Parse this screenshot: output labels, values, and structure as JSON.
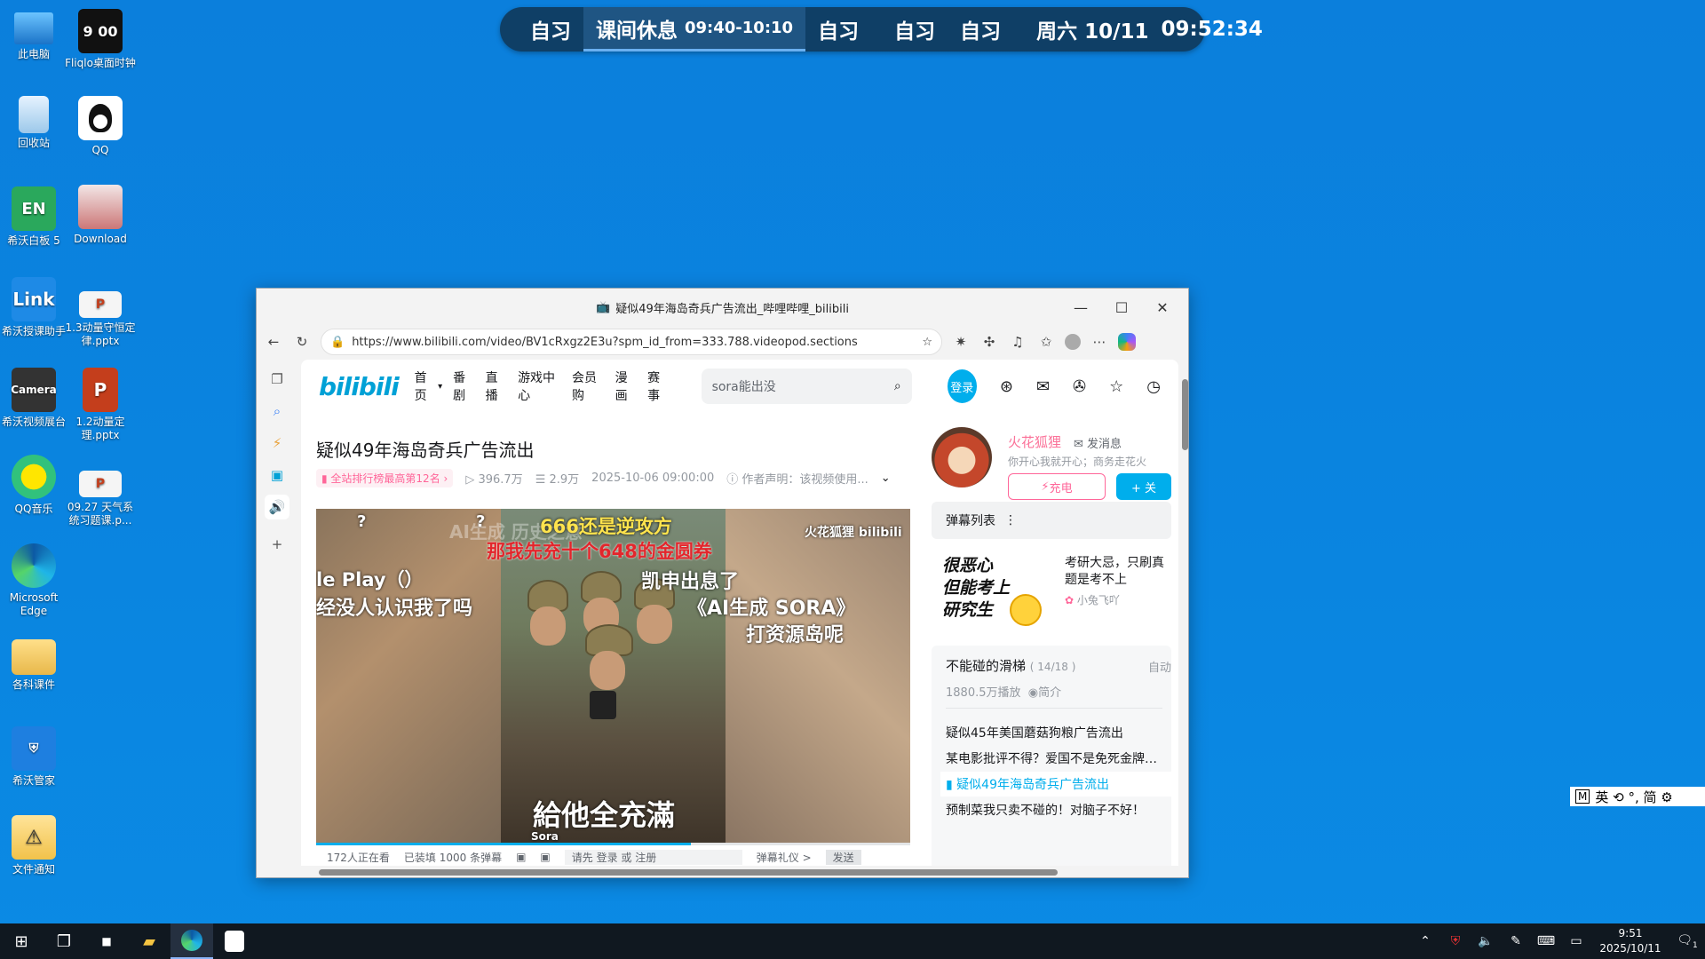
{
  "desktop": {
    "icons": [
      {
        "label": "此电脑",
        "icon": "computer-icon"
      },
      {
        "label": "Fliqlo桌面时钟",
        "icon": "clock-icon",
        "glyph": "9 00"
      },
      {
        "label": "回收站",
        "icon": "recycle-bin-icon"
      },
      {
        "label": "QQ",
        "icon": "qq-icon"
      },
      {
        "label": "希沃白板 5",
        "icon": "seewo-board-icon",
        "glyph": "EN"
      },
      {
        "label": "Download",
        "icon": "download-folder-icon"
      },
      {
        "label": "希沃授课助手",
        "icon": "seewo-link-icon",
        "glyph": "Link"
      },
      {
        "label": "1.3动量守恒定律.pptx",
        "icon": "pptx-file-icon",
        "glyph": "P"
      },
      {
        "label": "希沃视频展台",
        "icon": "camera-icon",
        "glyph": "Camera"
      },
      {
        "label": "1.2动量定理.pptx",
        "icon": "pptx-file-icon",
        "glyph": "P"
      },
      {
        "label": "QQ音乐",
        "icon": "qq-music-icon"
      },
      {
        "label": "09.27 天气系统习题课.p...",
        "icon": "pptx-file-icon",
        "glyph": "P"
      },
      {
        "label": "Microsoft Edge",
        "icon": "edge-icon"
      },
      {
        "label": "各科课件",
        "icon": "folder-icon"
      },
      {
        "label": "希沃管家",
        "icon": "seewo-guard-icon"
      },
      {
        "label": "文件通知",
        "icon": "file-warning-icon"
      }
    ]
  },
  "schedule": {
    "items": [
      "自习",
      "课间休息",
      "09:40-10:10",
      "自习",
      "自习",
      "自习"
    ],
    "date": "周六 10/11",
    "time": "09:52:34"
  },
  "browser": {
    "window_title": "疑似49年海岛奇兵广告流出_哔哩哔哩_bilibili",
    "url": "https://www.bilibili.com/video/BV1cRxgz2E3u?spm_id_from=333.788.videopod.sections",
    "controls": {
      "minimize": "—",
      "maximize": "☐",
      "close": "✕"
    }
  },
  "bili": {
    "logo": "bilibili",
    "nav": [
      "首页",
      "番剧",
      "直播",
      "游戏中心",
      "会员购",
      "漫画",
      "赛事"
    ],
    "search_placeholder": "sora能出没",
    "login": "登录",
    "video": {
      "title": "疑似49年海岛奇兵广告流出",
      "rank": "全站排行榜最高第12名",
      "views": "396.7万",
      "danmaku_count": "2.9万",
      "date": "2025-10-06 09:00:00",
      "statement": "作者声明：该视频使用..."
    },
    "player": {
      "dm_yellow": "666还是逆攻方",
      "dm_red": "那我先充十个648的金圆券",
      "dm_1": "凯申出息了",
      "dm_2": "《AI生成 SORA》",
      "dm_3": "打资源岛呢",
      "dm_left1": "le Play（）",
      "dm_left2": "经没人认识我了吗",
      "watermark": "火花狐狸 bilibili",
      "faded": "AI生成 历史之意",
      "subtitle": "給他全充滿",
      "sora": "Sora",
      "q1": "?",
      "q2": "?"
    },
    "controlbar": {
      "watching": "172人正在看",
      "loaded": "已装填 1000 条弹幕",
      "prompt": "请先 登录 或 注册",
      "etiquette": "弹幕礼仪 >",
      "send": "发送"
    },
    "uploader": {
      "name": "火花狐狸",
      "message": "发消息",
      "desc": "你开心我就开心；商务走花火",
      "charge": "充电",
      "follow": "+ 关"
    },
    "danmaku_list": "弹幕列表",
    "ad": {
      "big": [
        "很恶心",
        "但能考上",
        "研究生"
      ],
      "text": "考研大忌，只刷真题是考不上",
      "author": "小兔飞吖"
    },
    "collection": {
      "title": "不能碰的滑梯",
      "count": "( 14/18 )",
      "auto": "自动",
      "plays": "1880.5万播放",
      "intro": "简介",
      "episodes": [
        "疑似45年美国蘑菇狗粮广告流出",
        "某电影批评不得？爱国不是免死金牌…",
        "疑似49年海岛奇兵广告流出",
        "预制菜我只卖不碰的！对脑子不好！"
      ],
      "active_index": 2
    }
  },
  "ime": {
    "text": "英 ⟲ °, 简 ⚙"
  },
  "taskbar": {
    "clock_time": "9:51",
    "clock_date": "2025/10/11",
    "notification_count": "1"
  }
}
